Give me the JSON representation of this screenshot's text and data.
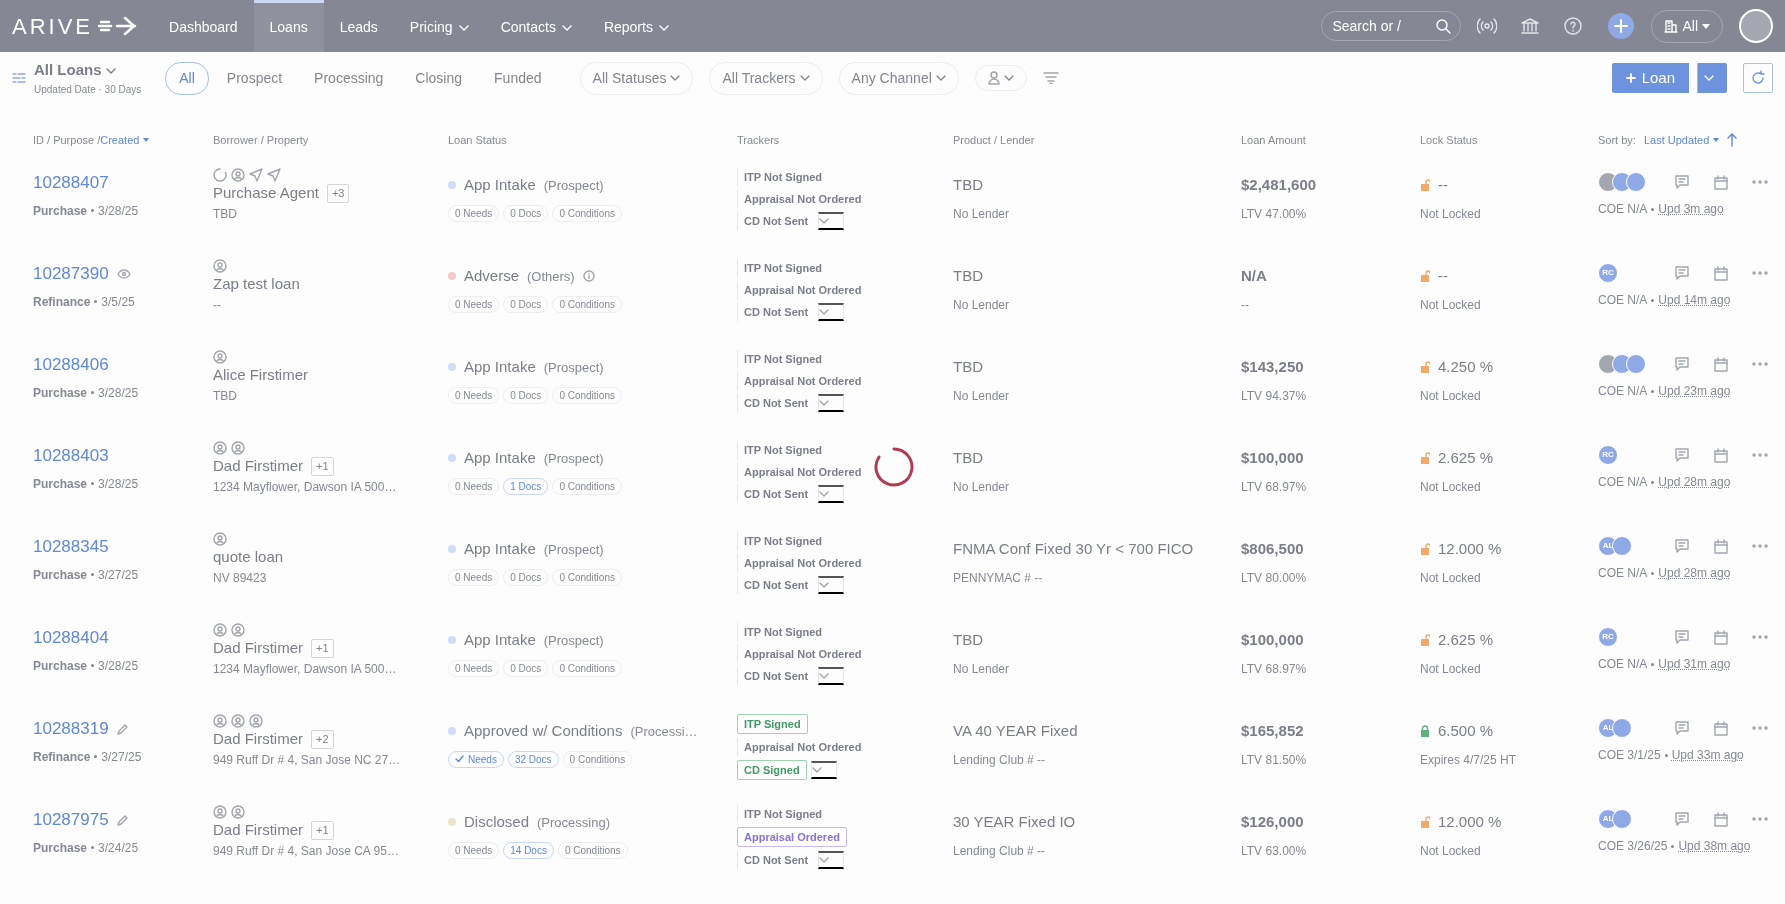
{
  "nav": {
    "logo": "ARIVE",
    "items": [
      {
        "label": "Dashboard",
        "selected": false,
        "dropdown": false
      },
      {
        "label": "Loans",
        "selected": true,
        "dropdown": false
      },
      {
        "label": "Leads",
        "selected": false,
        "dropdown": false
      },
      {
        "label": "Pricing",
        "selected": false,
        "dropdown": true
      },
      {
        "label": "Contacts",
        "selected": false,
        "dropdown": true
      },
      {
        "label": "Reports",
        "selected": false,
        "dropdown": true
      }
    ],
    "search": {
      "placeholder": "Search or /"
    },
    "company": "All"
  },
  "toolbar": {
    "view": "All Loans",
    "view_sub": "Updated Date · 30 Days",
    "tabs": [
      {
        "label": "All",
        "selected": true
      },
      {
        "label": "Prospect",
        "selected": false
      },
      {
        "label": "Processing",
        "selected": false
      },
      {
        "label": "Closing",
        "selected": false
      },
      {
        "label": "Funded",
        "selected": false
      }
    ],
    "filters": [
      "All Statuses",
      "All Trackers",
      "Any Channel"
    ],
    "new_button": "Loan"
  },
  "columns": {
    "id_prefix": "ID / Purpose / ",
    "id_sort": "Created",
    "borrower": "Borrower / Property",
    "status": "Loan Status",
    "trackers": "Trackers",
    "product": "Product / Lender",
    "amount": "Loan Amount",
    "lock": "Lock Status",
    "sort_label": "Sort by:",
    "sort_value": "Last Updated"
  },
  "rows": [
    {
      "id": "10288407",
      "purpose": "Purchase",
      "created": "3/28/25",
      "icons": [
        {
          "kind": "loading"
        },
        {
          "kind": "user"
        },
        {
          "kind": "send"
        },
        {
          "kind": "send"
        }
      ],
      "borrower": "Purchase Agent",
      "extra": "+3",
      "property": "TBD",
      "status": "App Intake",
      "color": "#cfdcf7",
      "stage": "(Prospect)",
      "info": false,
      "chips": [
        {
          "label": "0 Needs",
          "active": false,
          "checked": false
        },
        {
          "label": "0 Docs",
          "active": false,
          "checked": false
        },
        {
          "label": "0 Conditions",
          "active": false,
          "checked": false
        }
      ],
      "trackers": [
        {
          "label": "ITP Not Signed",
          "kind": "plain"
        },
        {
          "label": "Appraisal Not Ordered",
          "kind": "plain"
        },
        {
          "label": "CD Not Sent",
          "kind": "plain"
        }
      ],
      "product": "TBD",
      "lender": "No Lender",
      "amount": "$2,481,600",
      "ltv": "LTV 47.00%",
      "locked": false,
      "rate": "--",
      "lock_note": "Not Locked",
      "avatars": [
        {
          "kind": "photo"
        },
        {
          "kind": "blank"
        },
        {
          "kind": "blank"
        }
      ],
      "coe": "COE N/A",
      "updated": "Upd 3m ago"
    },
    {
      "id": "10287390",
      "id_icon": {
        "kind": "eye"
      },
      "purpose": "Refinance",
      "created": "3/5/25",
      "icons": [
        {
          "kind": "user"
        }
      ],
      "borrower": "Zap test loan",
      "extra": "",
      "property": "--",
      "status": "Adverse",
      "color": "#f5cac6",
      "stage": "(Others)",
      "info": true,
      "chips": [
        {
          "label": "0 Needs",
          "active": false,
          "checked": false
        },
        {
          "label": "0 Docs",
          "active": false,
          "checked": false
        },
        {
          "label": "0 Conditions",
          "active": false,
          "checked": false
        }
      ],
      "trackers": [
        {
          "label": "ITP Not Signed",
          "kind": "plain"
        },
        {
          "label": "Appraisal Not Ordered",
          "kind": "plain"
        },
        {
          "label": "CD Not Sent",
          "kind": "plain"
        }
      ],
      "product": "TBD",
      "lender": "No Lender",
      "amount": "N/A",
      "ltv": "--",
      "locked": false,
      "rate": "--",
      "lock_note": "Not Locked",
      "avatars": [
        {
          "kind": "initials",
          "text": "RC"
        }
      ],
      "coe": "COE N/A",
      "updated": "Upd 14m ago"
    },
    {
      "id": "10288406",
      "purpose": "Purchase",
      "created": "3/28/25",
      "icons": [
        {
          "kind": "user"
        }
      ],
      "borrower": "Alice Firstimer",
      "extra": "",
      "property": "TBD",
      "status": "App Intake",
      "color": "#cfdcf7",
      "stage": "(Prospect)",
      "info": false,
      "chips": [
        {
          "label": "0 Needs",
          "active": false,
          "checked": false
        },
        {
          "label": "0 Docs",
          "active": false,
          "checked": false
        },
        {
          "label": "0 Conditions",
          "active": false,
          "checked": false
        }
      ],
      "trackers": [
        {
          "label": "ITP Not Signed",
          "kind": "plain"
        },
        {
          "label": "Appraisal Not Ordered",
          "kind": "plain"
        },
        {
          "label": "CD Not Sent",
          "kind": "plain"
        }
      ],
      "product": "TBD",
      "lender": "No Lender",
      "amount": "$143,250",
      "ltv": "LTV 94.37%",
      "locked": false,
      "rate": "4.250 %",
      "lock_note": "Not Locked",
      "avatars": [
        {
          "kind": "photo"
        },
        {
          "kind": "blank"
        },
        {
          "kind": "blank"
        }
      ],
      "coe": "COE N/A",
      "updated": "Upd 23m ago"
    },
    {
      "id": "10288403",
      "purpose": "Purchase",
      "created": "3/28/25",
      "icons": [
        {
          "kind": "user"
        },
        {
          "kind": "user"
        }
      ],
      "borrower": "Dad Firstimer",
      "extra": "+1",
      "property": "1234 Mayflower, Dawson IA 500…",
      "status": "App Intake",
      "color": "#cfdcf7",
      "stage": "(Prospect)",
      "info": false,
      "chips": [
        {
          "label": "0 Needs",
          "active": false,
          "checked": false
        },
        {
          "label": "1 Docs",
          "active": true,
          "checked": false
        },
        {
          "label": "0 Conditions",
          "active": false,
          "checked": false
        }
      ],
      "trackers": [
        {
          "label": "ITP Not Signed",
          "kind": "plain"
        },
        {
          "label": "Appraisal Not Ordered",
          "kind": "plain"
        },
        {
          "label": "CD Not Sent",
          "kind": "plain"
        }
      ],
      "product": "TBD",
      "lender": "No Lender",
      "amount": "$100,000",
      "ltv": "LTV 68.97%",
      "locked": false,
      "rate": "2.625 %",
      "lock_note": "Not Locked",
      "avatars": [
        {
          "kind": "initials",
          "text": "RC"
        }
      ],
      "coe": "COE N/A",
      "updated": "Upd 28m ago"
    },
    {
      "id": "10288345",
      "purpose": "Purchase",
      "created": "3/27/25",
      "icons": [
        {
          "kind": "user"
        }
      ],
      "borrower": "quote loan",
      "extra": "",
      "property": "NV 89423",
      "status": "App Intake",
      "color": "#cfdcf7",
      "stage": "(Prospect)",
      "info": false,
      "chips": [
        {
          "label": "0 Needs",
          "active": false,
          "checked": false
        },
        {
          "label": "0 Docs",
          "active": false,
          "checked": false
        },
        {
          "label": "0 Conditions",
          "active": false,
          "checked": false
        }
      ],
      "trackers": [
        {
          "label": "ITP Not Signed",
          "kind": "plain"
        },
        {
          "label": "Appraisal Not Ordered",
          "kind": "plain"
        },
        {
          "label": "CD Not Sent",
          "kind": "plain"
        }
      ],
      "product": "FNMA Conf Fixed 30 Yr < 700 FICO",
      "lender": "PENNYMAC # --",
      "amount": "$806,500",
      "ltv": "LTV 80.00%",
      "locked": false,
      "rate": "12.000 %",
      "lock_note": "Not Locked",
      "avatars": [
        {
          "kind": "initials",
          "text": "AL"
        },
        {
          "kind": "blank"
        }
      ],
      "coe": "COE N/A",
      "updated": "Upd 28m ago"
    },
    {
      "id": "10288404",
      "purpose": "Purchase",
      "created": "3/28/25",
      "icons": [
        {
          "kind": "user"
        },
        {
          "kind": "user"
        }
      ],
      "borrower": "Dad Firstimer",
      "extra": "+1",
      "property": "1234 Mayflower, Dawson IA 500…",
      "status": "App Intake",
      "color": "#cfdcf7",
      "stage": "(Prospect)",
      "info": false,
      "chips": [
        {
          "label": "0 Needs",
          "active": false,
          "checked": false
        },
        {
          "label": "0 Docs",
          "active": false,
          "checked": false
        },
        {
          "label": "0 Conditions",
          "active": false,
          "checked": false
        }
      ],
      "trackers": [
        {
          "label": "ITP Not Signed",
          "kind": "plain"
        },
        {
          "label": "Appraisal Not Ordered",
          "kind": "plain"
        },
        {
          "label": "CD Not Sent",
          "kind": "plain"
        }
      ],
      "product": "TBD",
      "lender": "No Lender",
      "amount": "$100,000",
      "ltv": "LTV 68.97%",
      "locked": false,
      "rate": "2.625 %",
      "lock_note": "Not Locked",
      "avatars": [
        {
          "kind": "initials",
          "text": "RC"
        }
      ],
      "coe": "COE N/A",
      "updated": "Upd 31m ago"
    },
    {
      "id": "10288319",
      "id_icon": {
        "kind": "pencil"
      },
      "purpose": "Refinance",
      "created": "3/27/25",
      "icons": [
        {
          "kind": "user"
        },
        {
          "kind": "user"
        },
        {
          "kind": "user"
        }
      ],
      "borrower": "Dad Firstimer",
      "extra": "+2",
      "property": "949 Ruff Dr # 4, San Jose NC 27…",
      "status": "Approved w/ Conditions",
      "color": "#cfdcf7",
      "stage": "(Processi…",
      "info": false,
      "chips": [
        {
          "label": "Needs",
          "active": true,
          "checked": true
        },
        {
          "label": "32 Docs",
          "active": true,
          "checked": false
        },
        {
          "label": "0 Conditions",
          "active": false,
          "checked": false
        }
      ],
      "trackers": [
        {
          "label": "ITP Signed",
          "kind": "signed"
        },
        {
          "label": "Appraisal Not Ordered",
          "kind": "plain"
        },
        {
          "label": "CD Signed",
          "kind": "signed"
        }
      ],
      "product": "VA 40 YEAR Fixed",
      "lender": "Lending Club # --",
      "amount": "$165,852",
      "ltv": "LTV 81.50%",
      "locked": true,
      "rate": "6.500 %",
      "lock_note": "Expires 4/7/25 HT",
      "avatars": [
        {
          "kind": "initials",
          "text": "AL"
        },
        {
          "kind": "blank"
        }
      ],
      "coe": "COE 3/1/25",
      "updated": "Upd 33m ago"
    },
    {
      "id": "10287975",
      "id_icon": {
        "kind": "pencil"
      },
      "purpose": "Purchase",
      "created": "3/24/25",
      "icons": [
        {
          "kind": "user"
        },
        {
          "kind": "user"
        }
      ],
      "borrower": "Dad Firstimer",
      "extra": "+1",
      "property": "949 Ruff Dr # 4, San Jose CA 95…",
      "status": "Disclosed",
      "color": "#ede4cc",
      "stage": "(Processing)",
      "info": false,
      "chips": [
        {
          "label": "0 Needs",
          "active": false,
          "checked": false
        },
        {
          "label": "14 Docs",
          "active": true,
          "checked": false
        },
        {
          "label": "0 Conditions",
          "active": false,
          "checked": false
        }
      ],
      "trackers": [
        {
          "label": "ITP Not Signed",
          "kind": "plain"
        },
        {
          "label": "Appraisal Ordered",
          "kind": "ordered"
        },
        {
          "label": "CD Not Sent",
          "kind": "plain"
        }
      ],
      "product": "30 YEAR Fixed IO",
      "lender": "Lending Club # --",
      "amount": "$126,000",
      "ltv": "LTV 63.00%",
      "locked": false,
      "rate": "12.000 %",
      "lock_note": "Not Locked",
      "avatars": [
        {
          "kind": "initials",
          "text": "AL"
        },
        {
          "kind": "blank"
        }
      ],
      "coe": "COE 3/26/25",
      "updated": "Upd 38m ago"
    }
  ],
  "loading": true
}
